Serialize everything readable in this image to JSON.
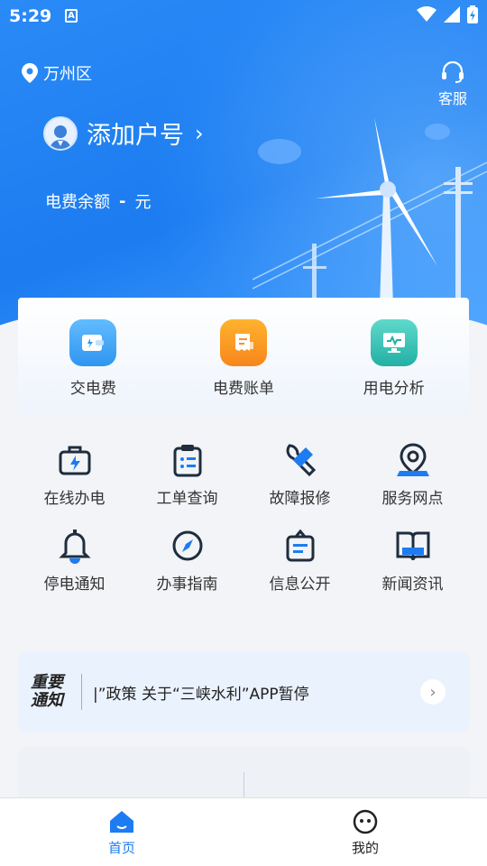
{
  "status": {
    "time": "5:29",
    "notif_icon": "A"
  },
  "header": {
    "location": "万州区",
    "service_label": "客服",
    "account_label": "添加户号",
    "balance_label": "电费余额",
    "balance_value": "-",
    "balance_unit": "元"
  },
  "quick": [
    {
      "label": "交电费",
      "icon": "wallet-icon",
      "color": "#3fa3f5"
    },
    {
      "label": "电费账单",
      "icon": "bill-icon",
      "color": "#f7941e"
    },
    {
      "label": "用电分析",
      "icon": "monitor-chart-icon",
      "color": "#2fc0b3"
    }
  ],
  "grid": [
    {
      "label": "在线办电",
      "icon": "briefcase-bolt-icon"
    },
    {
      "label": "工单查询",
      "icon": "clipboard-list-icon"
    },
    {
      "label": "故障报修",
      "icon": "wrench-icon"
    },
    {
      "label": "服务网点",
      "icon": "location-pin-icon"
    },
    {
      "label": "停电通知",
      "icon": "bell-icon"
    },
    {
      "label": "办事指南",
      "icon": "compass-icon"
    },
    {
      "label": "信息公开",
      "icon": "bag-document-icon"
    },
    {
      "label": "新闻资讯",
      "icon": "book-icon"
    }
  ],
  "notice": {
    "tag_line1": "重要",
    "tag_line2": "通知",
    "text": "|”政策        关于“三峡水利”APP暂停"
  },
  "tabs": [
    {
      "label": "首页",
      "active": true
    },
    {
      "label": "我的",
      "active": false
    }
  ],
  "colors": {
    "accent": "#1d7cf2",
    "hero": "#2a8af6"
  }
}
